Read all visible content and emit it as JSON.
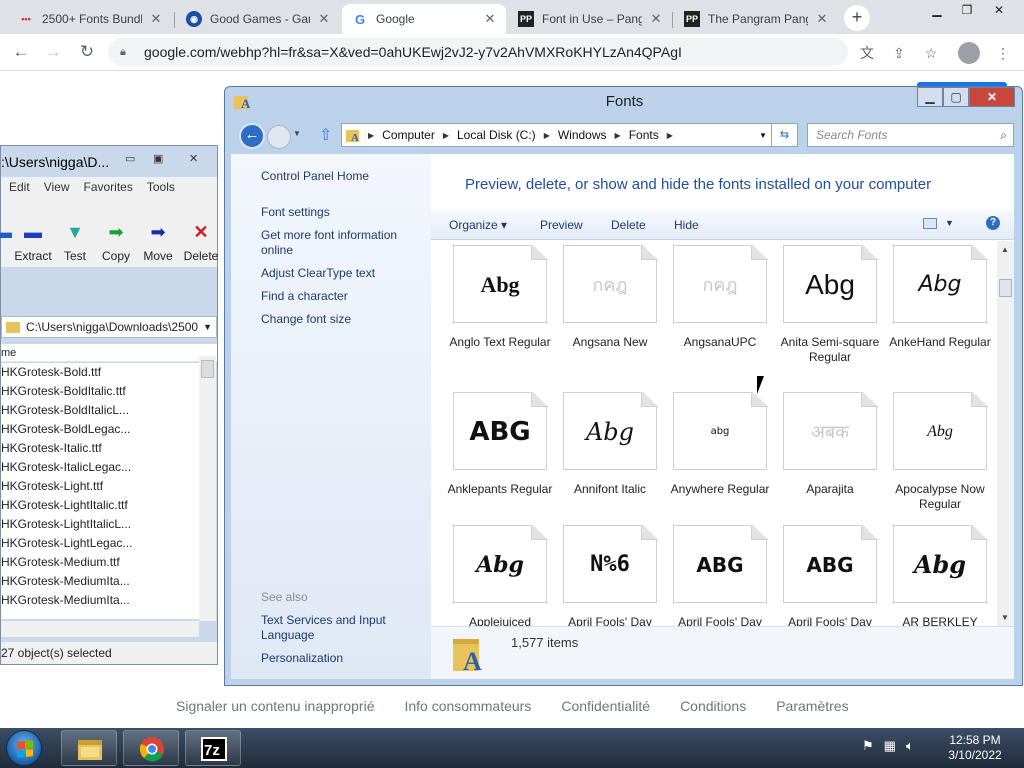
{
  "browser": {
    "tabs": [
      {
        "title": "2500+ Fonts Bundl",
        "active": false
      },
      {
        "title": "Good Games - Gar",
        "active": false
      },
      {
        "title": "Google",
        "active": true
      },
      {
        "title": "Font in Use – Pang",
        "active": false
      },
      {
        "title": "The Pangram Pang",
        "active": false
      }
    ],
    "url": "google.com/webhp?hl=fr&sa=X&ved=0ahUKEwj2vJ2-y7v2AhVMXRoKHYLzAn4QPAgI",
    "footer_links": [
      "Signaler un contenu inapproprié",
      "Info consommateurs",
      "Confidentialité",
      "Conditions",
      "Paramètres"
    ]
  },
  "zip": {
    "title": ":\\Users\\nigga\\D...",
    "menu": [
      "Edit",
      "View",
      "Favorites",
      "Tools"
    ],
    "toolbar": [
      "Extract",
      "Test",
      "Copy",
      "Move",
      "Delete"
    ],
    "path": "C:\\Users\\nigga\\Downloads\\2500",
    "column": "me",
    "files": [
      "HKGrotesk-Bold.ttf",
      "HKGrotesk-BoldItalic.ttf",
      "HKGrotesk-BoldItalicL...",
      "HKGrotesk-BoldLegac...",
      "HKGrotesk-Italic.ttf",
      "HKGrotesk-ItalicLegac...",
      "HKGrotesk-Light.ttf",
      "HKGrotesk-LightItalic.ttf",
      "HKGrotesk-LightItalicL...",
      "HKGrotesk-LightLegac...",
      "HKGrotesk-Medium.ttf",
      "HKGrotesk-MediumIta...",
      "HKGrotesk-MediumIta..."
    ],
    "status": "27 object(s) selected"
  },
  "fonts_window": {
    "title": "Fonts",
    "breadcrumb": [
      "Computer",
      "Local Disk (C:)",
      "Windows",
      "Fonts"
    ],
    "search_placeholder": "Search Fonts",
    "sidebar_links": [
      "Control Panel Home",
      "Font settings",
      "Get more font information online",
      "Adjust ClearType text",
      "Find a character",
      "Change font size"
    ],
    "see_also_heading": "See also",
    "see_also_links": [
      "Text Services and Input Language",
      "Personalization"
    ],
    "heading": "Preview, delete, or show and hide the fonts installed on your computer",
    "commands": [
      "Organize ▾",
      "Preview",
      "Delete",
      "Hide"
    ],
    "fonts": [
      {
        "name": "Anglo Text Regular",
        "sample": "Abg",
        "faint": false,
        "stack": false
      },
      {
        "name": "Angsana New",
        "sample": "กคฎ",
        "faint": true,
        "stack": true
      },
      {
        "name": "AngsanaUPC",
        "sample": "กคฎ",
        "faint": true,
        "stack": true
      },
      {
        "name": "Anita Semi-square Regular",
        "sample": "Abg",
        "faint": false,
        "stack": false
      },
      {
        "name": "AnkeHand Regular",
        "sample": "Abg",
        "faint": false,
        "stack": false
      },
      {
        "name": "Anklepants Regular",
        "sample": "ABG",
        "faint": false,
        "stack": false
      },
      {
        "name": "Annifont Italic",
        "sample": "Abg",
        "faint": false,
        "stack": false
      },
      {
        "name": "Anywhere Regular",
        "sample": "abg",
        "faint": false,
        "stack": false
      },
      {
        "name": "Aparajita",
        "sample": "अबक",
        "faint": true,
        "stack": true
      },
      {
        "name": "Apocalypse Now Regular",
        "sample": "Abg",
        "faint": false,
        "stack": false
      },
      {
        "name": "Applejuiced",
        "sample": "Abg",
        "faint": false,
        "stack": false
      },
      {
        "name": "April Fools' Day",
        "sample": "N%6",
        "faint": false,
        "stack": false
      },
      {
        "name": "April Fools' Day",
        "sample": "ABG",
        "faint": false,
        "stack": false
      },
      {
        "name": "April Fools' Day",
        "sample": "ABG",
        "faint": false,
        "stack": false
      },
      {
        "name": "AR BERKLEY",
        "sample": "Abg",
        "faint": false,
        "stack": false
      }
    ],
    "item_count": "1,577 items"
  },
  "taskbar": {
    "apps": [
      "explorer",
      "chrome",
      "7zip"
    ],
    "time": "12:58 PM",
    "date": "3/10/2022"
  }
}
